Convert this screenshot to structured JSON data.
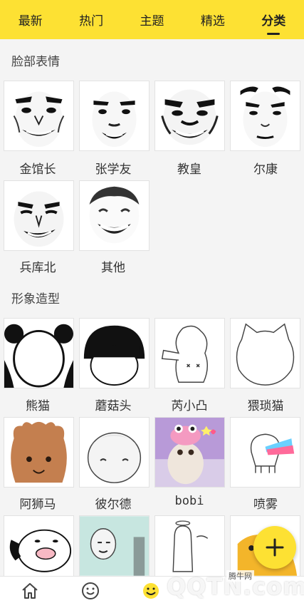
{
  "tabs": [
    {
      "label": "最新"
    },
    {
      "label": "热门"
    },
    {
      "label": "主题"
    },
    {
      "label": "精选"
    },
    {
      "label": "分类"
    }
  ],
  "sections": {
    "face": {
      "title": "脸部表情",
      "items": [
        {
          "label": "金馆长"
        },
        {
          "label": "张学友"
        },
        {
          "label": "教皇"
        },
        {
          "label": "尔康"
        },
        {
          "label": "兵库北"
        },
        {
          "label": "其他"
        }
      ]
    },
    "image": {
      "title": "形象造型",
      "items": [
        {
          "label": "熊猫"
        },
        {
          "label": "蘑菇头"
        },
        {
          "label": "芮小凸"
        },
        {
          "label": "猥琐猫"
        },
        {
          "label": "阿狮马"
        },
        {
          "label": "彼尔德"
        },
        {
          "label": "bobi"
        },
        {
          "label": "喷雾"
        }
      ]
    }
  },
  "watermark": {
    "small": "腾牛网",
    "big": "QQTN.com"
  },
  "colors": {
    "accent": "#fde133"
  },
  "icons": [
    "home-icon",
    "smile-icon",
    "emoji-active-icon",
    "plus-icon"
  ]
}
